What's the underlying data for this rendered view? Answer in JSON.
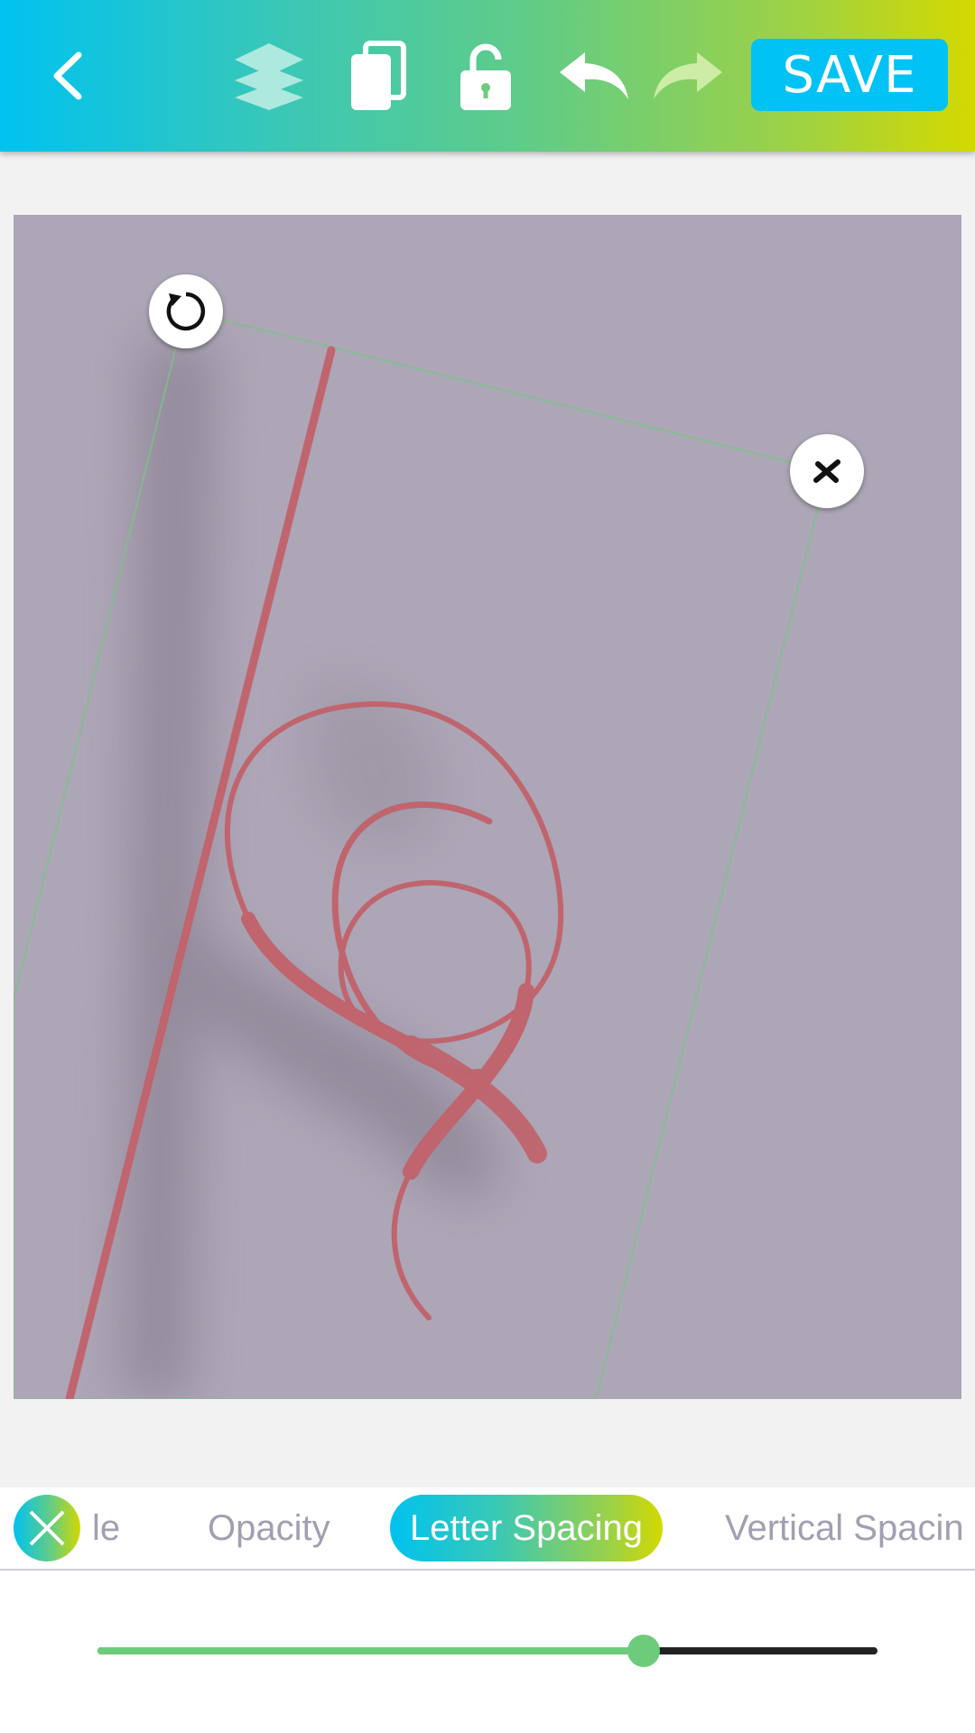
{
  "toolbar": {
    "save_label": "SAVE",
    "icons": [
      "back-icon",
      "layers-icon",
      "duplicate-icon",
      "unlock-icon",
      "undo-icon",
      "redo-icon"
    ],
    "gradient": [
      "#00c2f0",
      "#62cc86",
      "#d3d900"
    ]
  },
  "canvas": {
    "background": "#ada6b6",
    "stroke_color": "#c0646e",
    "handles": [
      "rotate-icon",
      "close-icon"
    ]
  },
  "tabs": {
    "items": [
      {
        "label": "le",
        "active": false
      },
      {
        "label": "Opacity",
        "active": false
      },
      {
        "label": "Letter Spacing",
        "active": true
      },
      {
        "label": "Vertical Spacin",
        "active": false
      }
    ]
  },
  "slider": {
    "label": "Letter Spacing",
    "value": 0.7,
    "fill_color": "#6ccc7c",
    "track_color": "#222222"
  }
}
